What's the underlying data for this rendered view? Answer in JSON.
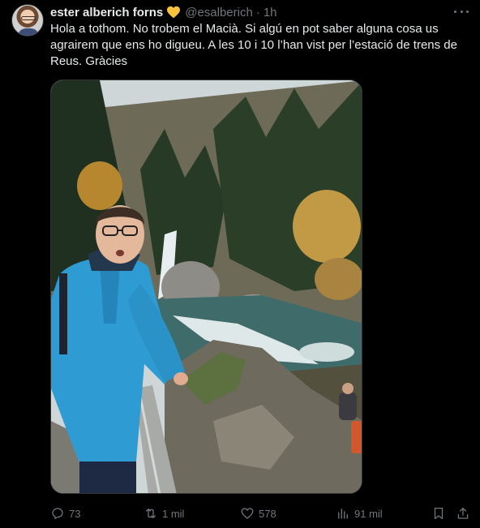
{
  "author": {
    "display_name": "ester alberich forns",
    "handle": "@esalberich",
    "separator": "·",
    "time": "1h",
    "badge_icon": "yellow-heart-icon"
  },
  "tweet": {
    "text": "Hola a tothom. No trobem el Macià. Si algú en pot saber alguna cosa us agrairem que ens ho digueu. A les 10 i 10 l’han vist per l’estació de trens de Reus. Gràcies"
  },
  "media": {
    "description_icon": "photo"
  },
  "actions": {
    "replies": "73",
    "reposts": "1 mil",
    "likes": "578",
    "views": "91 mil"
  },
  "colors": {
    "background": "#000000",
    "text": "#e7e9ea",
    "muted": "#71767b",
    "heart": "#f9c23c"
  }
}
